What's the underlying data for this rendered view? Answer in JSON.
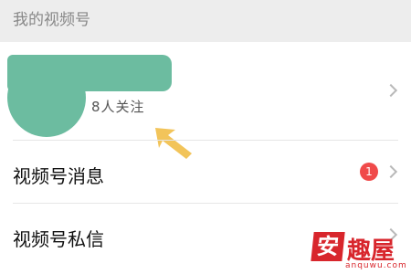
{
  "header": {
    "title": "我的视频号"
  },
  "profile": {
    "followers_text": "8人关注",
    "redaction_color": "#6cbca0"
  },
  "menu": [
    {
      "label": "视频号消息",
      "badge": "1"
    },
    {
      "label": "视频号私信"
    }
  ],
  "watermark": {
    "logo_char": "安",
    "text": "趣屋",
    "url": "anquwu.com"
  },
  "colors": {
    "accent_badge": "#f04a4a",
    "arrow": "#f2c45a",
    "brand_red": "#d8262c"
  }
}
